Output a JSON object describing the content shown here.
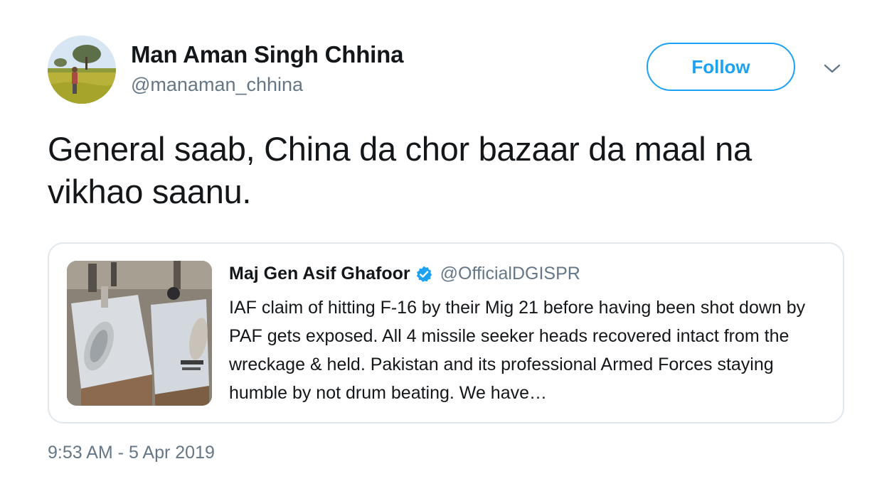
{
  "author": {
    "display_name": "Man Aman Singh Chhina",
    "handle": "@manaman_chhina",
    "avatar_icon": "profile-photo"
  },
  "actions": {
    "follow_label": "Follow",
    "menu_icon": "chevron-down-icon"
  },
  "tweet": {
    "text": "General saab, China da chor bazaar da maal na vikhao saanu.",
    "timestamp": "9:53 AM - 5 Apr 2019"
  },
  "quoted_tweet": {
    "author_name": "Maj Gen Asif Ghafoor",
    "verified": true,
    "author_handle": "@OfficialDGISPR",
    "text": "IAF claim of hitting F-16 by their Mig 21 before having been shot down by PAF gets exposed. All 4 missile seeker heads recovered intact from the wreckage & held. Pakistan and its professional Armed Forces staying humble by not drum beating. We have…",
    "media_icon": "missile-seeker-heads-photo"
  },
  "colors": {
    "accent": "#1da1f2",
    "text_primary": "#14171a",
    "text_secondary": "#657786",
    "border": "#e1e8ed"
  }
}
